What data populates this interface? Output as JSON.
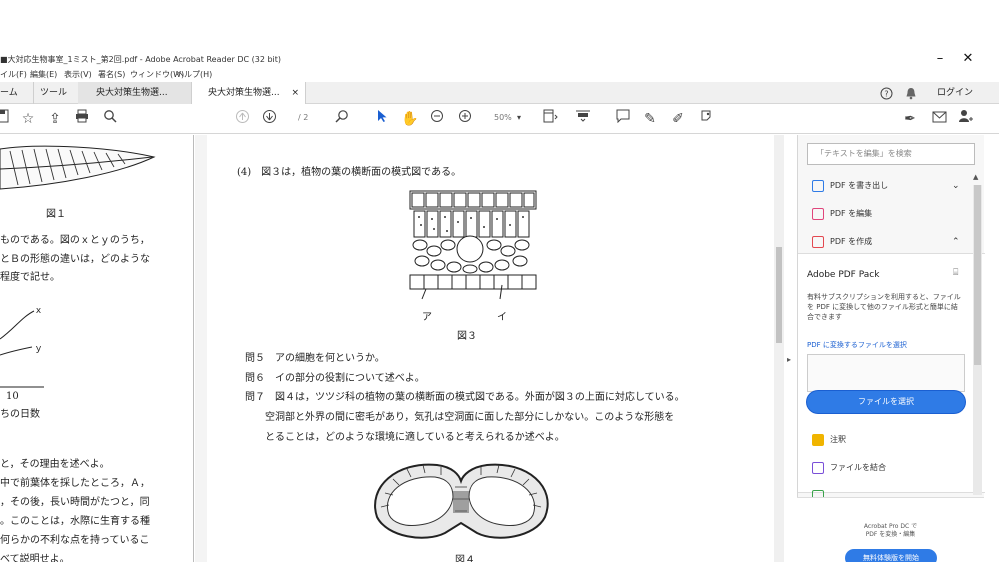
{
  "window": {
    "title": "■大対応生物事室_1ミスト_第2回.pdf - Adobe Acrobat Reader DC (32 bit)",
    "minimize_glyph": "–",
    "close_glyph": "✕"
  },
  "menu": [
    "イル(F)",
    "編集(E)",
    "表示(V)",
    "署名(S)",
    "ウィンドウ(W)",
    "ヘルプ(H)"
  ],
  "tabs": {
    "home": "ーム",
    "tools": "ツール",
    "doc1": "央大対策生物選...",
    "doc2": "央大対策生物選...",
    "close_glyph": "×"
  },
  "header_right": {
    "help_glyph": "?",
    "bell_glyph": "🔔",
    "login": "ログイン"
  },
  "toolbar": {
    "page_display": "/ 2",
    "zoom": "50%",
    "icons": [
      "save-icon",
      "bookmark-star-icon",
      "upload-icon",
      "print-icon",
      "search-icon",
      "page-up-icon",
      "page-down-icon",
      "find-icon",
      "select-cursor-icon",
      "hand-icon",
      "zoom-out-icon",
      "zoom-in-icon",
      "fit-page-icon",
      "scroll-mode-icon",
      "comment-icon",
      "highlight-icon",
      "draw-icon",
      "stamp-icon",
      "sign-icon",
      "mail-icon",
      "add-user-icon"
    ]
  },
  "left_page": {
    "fig1_caption": "図１",
    "lines": [
      "ものである。図のｘとｙのうち，",
      "とＢの形態の違いは，どのような",
      "程度で記せ。"
    ],
    "graph_label_x": "ｘ",
    "graph_label_y": "ｙ",
    "axis_tick": "10",
    "axis_title": "ちの日数",
    "lines2": [
      "と，その理由を述べよ。",
      "中で前葉体を採したところ，Ａ，",
      "，その後，長い時間がたつと，同",
      "。このことは，水際に生育する種",
      "何らかの不利な点を持っているこ",
      "べて説明せよ。"
    ]
  },
  "main_page": {
    "q4": "(4)　図３は，植物の葉の横断面の模式図である。",
    "label_a": "ア",
    "label_i": "イ",
    "fig3_caption": "図３",
    "q5": "問５　アの細胞を何というか。",
    "q6": "問６　イの部分の役割について述べよ。",
    "q7_line1": "問７　図４は，ツツジ科の植物の葉の横断面の模式図である。外面が図３の上面に対応している。",
    "q7_line2": "空洞部と外界の間に密毛があり，気孔は空洞面に面した部分にしかない。このような形態を",
    "q7_line3": "とることは，どのような環境に適していると考えられるか述べよ。",
    "fig4_caption": "図４"
  },
  "right_panel": {
    "search_placeholder": "「テキストを編集」を検索",
    "tools": [
      {
        "label": "PDF を書き出し",
        "color": "#2f7be6",
        "chevron": "⌄"
      },
      {
        "label": "PDF を編集",
        "color": "#e0457b",
        "chevron": ""
      },
      {
        "label": "PDF を作成",
        "color": "#e34850",
        "chevron": "⌃"
      }
    ],
    "pack_title": "Adobe PDF Pack",
    "pack_desc": "有料サブスクリプションを利用すると、ファイルを PDF に変換して他のファイル形式と簡単に結合できます",
    "pick_label": "PDF に変換するファイルを選択",
    "select_button": "ファイルを選択",
    "extra_tools": [
      {
        "label": "注釈",
        "color": "#f0b400"
      },
      {
        "label": "ファイルを結合",
        "color": "#7a4fd8"
      }
    ],
    "promo_line1": "Acrobat Pro DC で",
    "promo_line2": "PDF を変換・編集",
    "trial_button": "無料体験版を開始"
  }
}
